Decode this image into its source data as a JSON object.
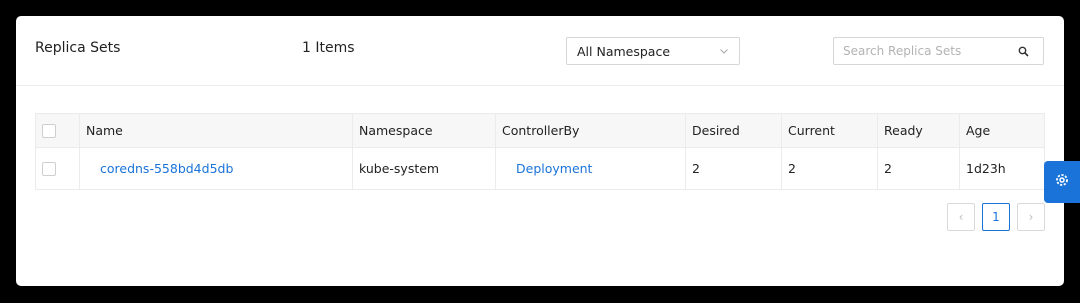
{
  "header": {
    "title": "Replica Sets",
    "count": "1 Items",
    "namespace_select": {
      "value": "All Namespace"
    },
    "search": {
      "placeholder": "Search Replica Sets",
      "value": ""
    }
  },
  "table": {
    "columns": [
      "Name",
      "Namespace",
      "ControllerBy",
      "Desired",
      "Current",
      "Ready",
      "Age"
    ],
    "rows": [
      {
        "name": "coredns-558bd4d5db",
        "namespace": "kube-system",
        "controller_by": "Deployment",
        "desired": "2",
        "current": "2",
        "ready": "2",
        "age": "1d23h"
      }
    ]
  },
  "pagination": {
    "prev_label": "‹",
    "current_page": "1",
    "next_label": "›"
  },
  "icons": {
    "chevron": "chevron-down-icon",
    "search": "search-icon",
    "settings": "gear-icon"
  },
  "colors": {
    "accent": "#1a73d9",
    "backdrop": "#000000"
  }
}
